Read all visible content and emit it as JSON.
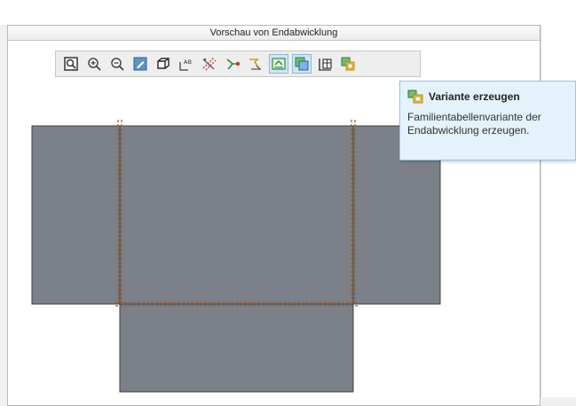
{
  "window": {
    "title": "Vorschau von Endabwicklung"
  },
  "toolbar": {
    "buttons": [
      {
        "icon": "zoom-window-icon",
        "active": false
      },
      {
        "icon": "zoom-in-icon",
        "active": false
      },
      {
        "icon": "zoom-out-icon",
        "active": false
      },
      {
        "icon": "edit-view-icon",
        "active": false
      },
      {
        "icon": "view-orientation-icon",
        "active": false
      },
      {
        "icon": "annotation-icon",
        "active": false
      },
      {
        "icon": "bend-lines-icon",
        "active": false
      },
      {
        "icon": "datum-point-icon",
        "active": false
      },
      {
        "icon": "datum-axis-icon",
        "active": false
      },
      {
        "icon": "flat-state-icon",
        "active": true
      },
      {
        "icon": "model-display-icon",
        "active": true
      },
      {
        "icon": "table-icon",
        "active": false
      },
      {
        "icon": "create-variant-icon",
        "active": false
      }
    ]
  },
  "tooltip": {
    "title": "Variante erzeugen",
    "description": "Familientabellenvariante der\nEndabwicklung erzeugen."
  },
  "colors": {
    "panel_fill": "#7c8189",
    "panel_stroke": "#3d3f44",
    "bend_line": "#a15a22",
    "tooltip_bg": "#e4f2fb",
    "active_button": "#cfe6f6"
  }
}
